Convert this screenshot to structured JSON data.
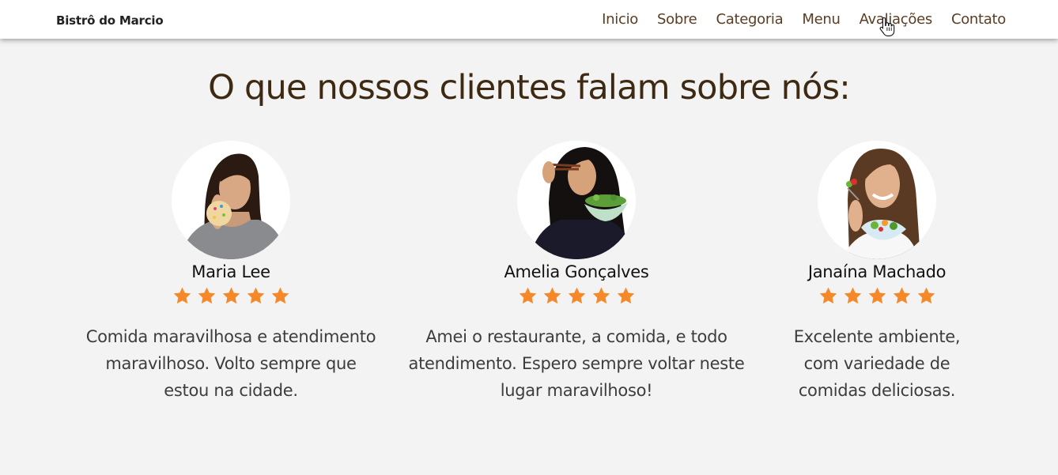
{
  "header": {
    "brand": "Bistrô do Marcio",
    "nav": [
      {
        "label": "Inicio"
      },
      {
        "label": "Sobre"
      },
      {
        "label": "Categoria"
      },
      {
        "label": "Menu"
      },
      {
        "label": "Avaliações"
      },
      {
        "label": "Contato"
      }
    ]
  },
  "testimonials": {
    "title": "O que nossos clientes falam sobre nós:",
    "star_color": "#f5892a",
    "items": [
      {
        "name": "Maria Lee",
        "rating": 5,
        "review": "Comida maravilhosa e atendimento maravilhoso. Volto sempre que estou na cidade."
      },
      {
        "name": "Amelia Gonçalves",
        "rating": 5,
        "review": "Amei o restaurante, a comida, e todo atendimento. Espero sempre voltar neste lugar maravilhoso!"
      },
      {
        "name": "Janaína Machado",
        "rating": 5,
        "review": "Excelente ambiente, com variedade de comidas deliciosas."
      }
    ]
  }
}
